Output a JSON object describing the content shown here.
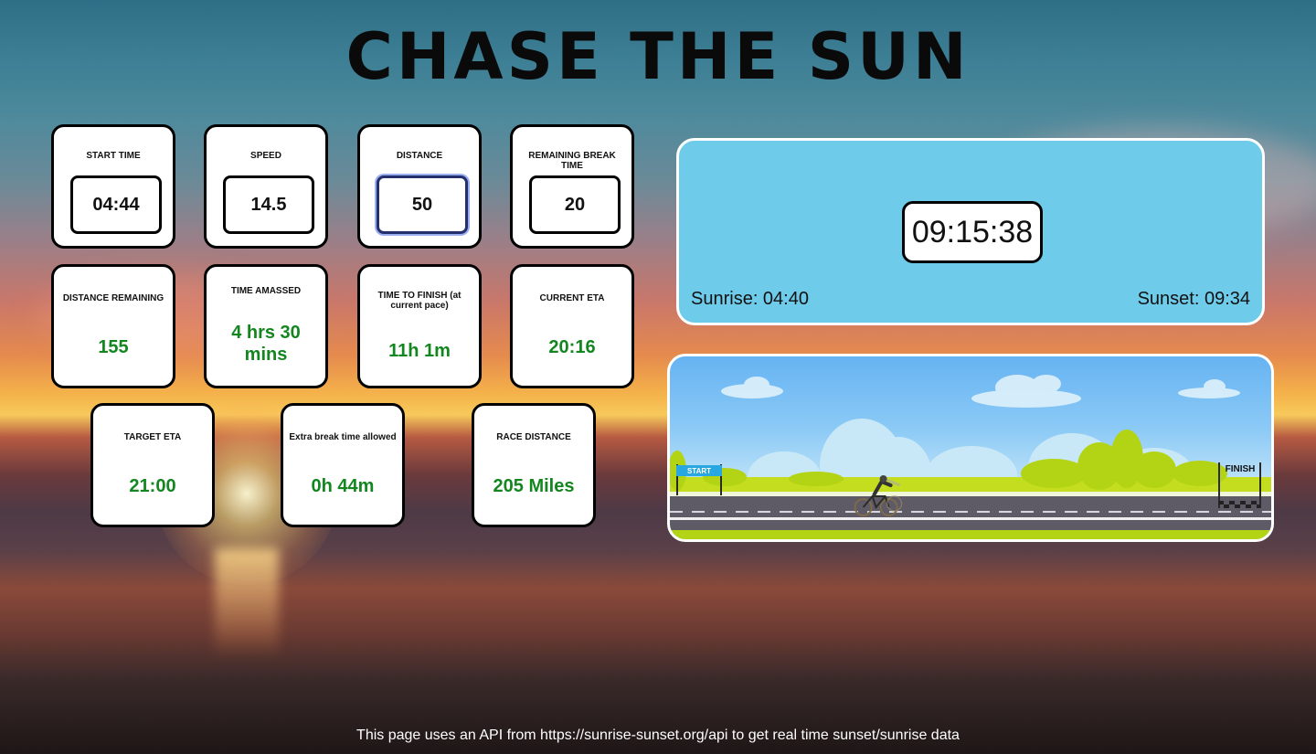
{
  "title": "CHASE THE SUN",
  "inputs": {
    "start_time": {
      "label": "START TIME",
      "value": "04:44"
    },
    "speed": {
      "label": "SPEED",
      "value": "14.5"
    },
    "distance": {
      "label": "DISTANCE",
      "value": "50"
    },
    "remaining_break": {
      "label": "REMAINING BREAK TIME",
      "value": "20"
    }
  },
  "stats": {
    "distance_remaining": {
      "label": "DISTANCE REMAINING",
      "value": "155"
    },
    "time_amassed": {
      "label": "TIME AMASSED",
      "value": "4 hrs 30 mins"
    },
    "time_to_finish": {
      "label": "TIME TO FINISH (at current pace)",
      "value": "11h 1m"
    },
    "current_eta": {
      "label": "CURRENT ETA",
      "value": "20:16"
    },
    "target_eta": {
      "label": "TARGET ETA",
      "value": "21:00"
    },
    "extra_break": {
      "label": "Extra break time allowed",
      "value": "0h 44m"
    },
    "race_distance": {
      "label": "RACE DISTANCE",
      "value": "205 Miles"
    }
  },
  "clock": {
    "time": "09:15:38",
    "sunrise": "Sunrise: 04:40",
    "sunset": "Sunset: 09:34"
  },
  "race": {
    "start_flag": "START",
    "finish_flag": "FINISH",
    "progress": 0.32
  },
  "footer": "This page uses an API from https://sunrise-sunset.org/api to get real time sunset/sunrise data",
  "colors": {
    "accent_green": "#13861f",
    "panel_blue": "#6ecbea"
  },
  "icons": [
    "bicycle-icon",
    "finish-flag-icon",
    "start-banner-icon"
  ]
}
